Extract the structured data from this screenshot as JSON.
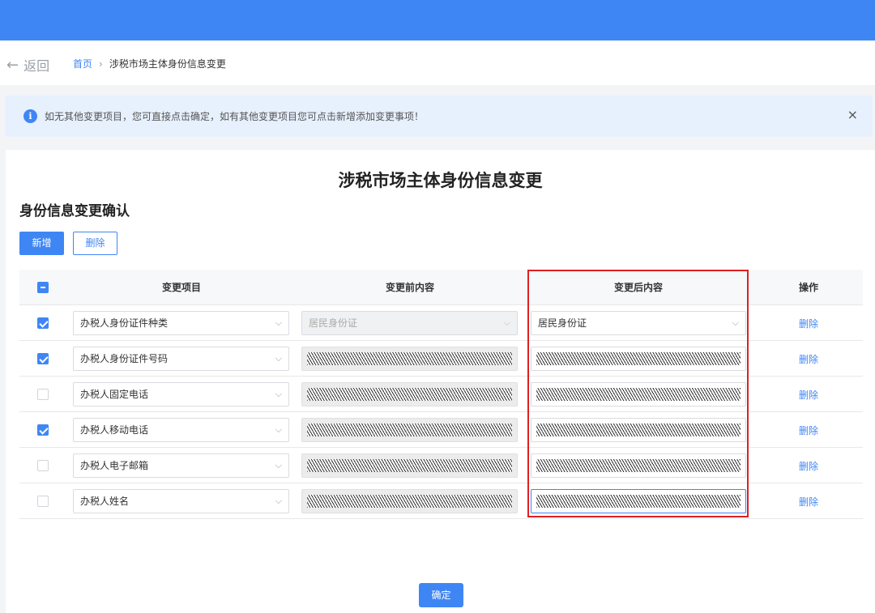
{
  "nav": {
    "back_label": "返回",
    "breadcrumb": [
      "首页",
      "涉税市场主体身份信息变更"
    ]
  },
  "alert": {
    "icon": "info-icon",
    "text": "如无其他变更项目，您可直接点击确定，如有其他变更项目您可点击新增添加变更事项！",
    "close": "×"
  },
  "page_title": "涉税市场主体身份信息变更",
  "section_title": "身份信息变更确认",
  "toolbar": {
    "add_label": "新增",
    "delete_label": "删除"
  },
  "table": {
    "headers": [
      "变更项目",
      "变更前内容",
      "变更后内容",
      "操作"
    ],
    "rows": [
      {
        "checked": true,
        "item": "办税人身份证件种类",
        "before": "居民身份证",
        "after": "居民身份证",
        "action": "删除"
      },
      {
        "checked": true,
        "item": "办税人身份证件号码",
        "before": "",
        "after": "",
        "action": "删除"
      },
      {
        "checked": false,
        "item": "办税人固定电话",
        "before": "",
        "after": "",
        "action": "删除"
      },
      {
        "checked": true,
        "item": "办税人移动电话",
        "before": "",
        "after": "",
        "action": "删除"
      },
      {
        "checked": false,
        "item": "办税人电子邮箱",
        "before": "",
        "after": "",
        "action": "删除"
      },
      {
        "checked": false,
        "item": "办税人姓名",
        "before": "",
        "after": "",
        "action": "删除"
      }
    ]
  },
  "confirm_label": "确定",
  "colors": {
    "brand": "#3f86f5",
    "highlight_border": "#e02020"
  }
}
